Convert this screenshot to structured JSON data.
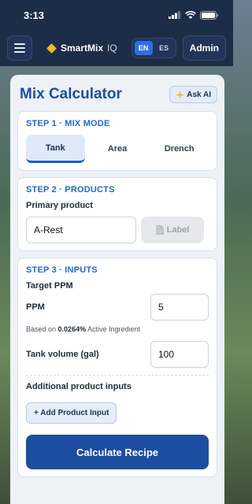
{
  "status_bar": {
    "time": "3:13"
  },
  "app_bar": {
    "brand_name": "SmartMix",
    "brand_suffix": "IQ",
    "languages": [
      "EN",
      "ES"
    ],
    "active_language": "EN",
    "admin_label": "Admin"
  },
  "calculator": {
    "title": "Mix Calculator",
    "ask_ai_label": "Ask AI",
    "step1": {
      "heading": "STEP 1 · MIX MODE",
      "tabs": [
        "Tank",
        "Area",
        "Drench"
      ],
      "selected": "Tank"
    },
    "step2": {
      "heading": "STEP 2 · PRODUCTS",
      "primary_label": "Primary product",
      "primary_value": "A-Rest",
      "label_button": "Label"
    },
    "step3": {
      "heading": "STEP 3 · INPUTS",
      "target_label": "Target PPM",
      "ppm_label": "PPM",
      "ppm_value": "5",
      "hint_prefix": "Based on",
      "hint_value": "0.0264%",
      "hint_suffix": "Active Ingredient",
      "tank_label": "Tank volume (gal)",
      "tank_value": "100",
      "additional_label": "Additional product inputs",
      "add_button": "+ Add Product Input"
    },
    "calculate_button": "Calculate Recipe"
  },
  "colors": {
    "accent": "#1b4ea0",
    "title": "#1a4fa3",
    "step_heading": "#2069c9",
    "app_bar": "#1c2d48",
    "brand_diamond": "#f2b72c"
  }
}
